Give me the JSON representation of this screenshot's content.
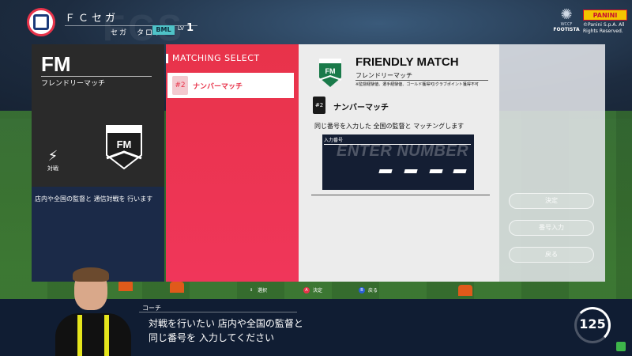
{
  "header": {
    "club_name": "ＦＣセガ",
    "user_name": "セガ　タロウ",
    "rank_badge": "BML",
    "level_label": "LV",
    "level_value": "1",
    "panini_logo": "PANINI",
    "wccf_line1": "WCCF",
    "wccf_line2": "FOOTISTA",
    "copyright": "©Panini S.p.A. All Rights Reserved."
  },
  "left_card": {
    "code": "FM",
    "subtitle": "フレンドリーマッチ",
    "shield_code": "FM",
    "versus_label": "対戦",
    "description": "店内や全国の監督と 通信対戦を 行います"
  },
  "matching": {
    "title": "MATCHING SELECT",
    "items": [
      {
        "label": "ナンバーマッチ",
        "icon": "number-match-icon",
        "selected": true
      }
    ]
  },
  "detail": {
    "logo_code": "FM",
    "title": "FRIENDLY MATCH",
    "subtitle": "フレンドリーマッチ",
    "note": "※監督経験値、選手経験値、ゴールド獲得可/クラブポイント獲得不可",
    "mode_label": "ナンバーマッチ",
    "mode_icon_text": "#2",
    "description": "同じ番号を入力した 全国の監督と マッチングします",
    "input_label": "入力番号",
    "input_placeholder": "ENTER NUMBER"
  },
  "side_buttons": [
    {
      "label": "決定"
    },
    {
      "label": "番号入力"
    },
    {
      "label": "戻る"
    }
  ],
  "hints": [
    {
      "key": "↕",
      "label": "選択"
    },
    {
      "key": "A",
      "label": "決定"
    },
    {
      "key": "B",
      "label": "戻る"
    }
  ],
  "dialog": {
    "speaker": "コーチ",
    "line1": "対戦を行いたい 店内や全国の監督と",
    "line2": "同じ番号を 入力してください"
  },
  "timer": {
    "value": "125"
  },
  "colors": {
    "accent_red": "#e8334a",
    "navy": "#101d33",
    "cyan_badge": "#4fc3c8",
    "fm_green": "#1a7a4a"
  }
}
